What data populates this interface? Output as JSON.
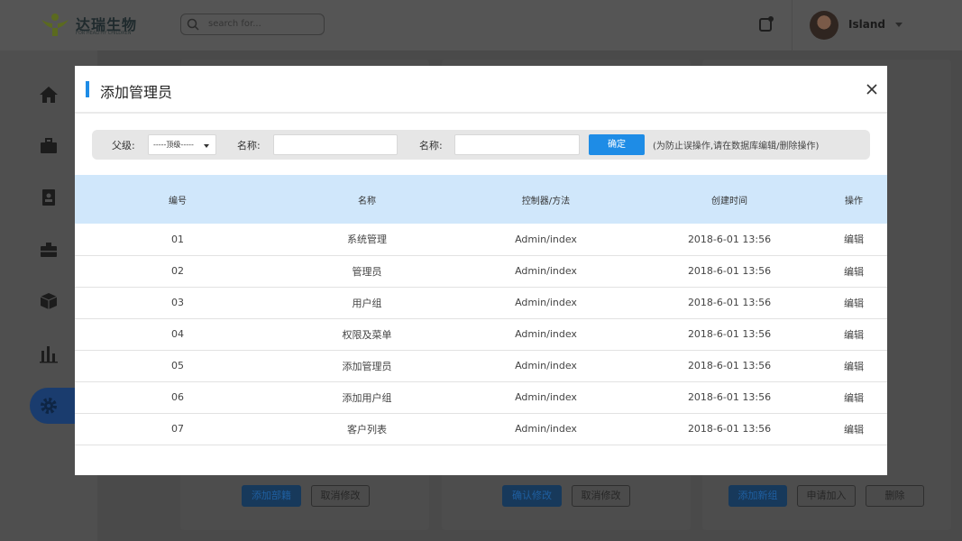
{
  "header": {
    "brand_name": "达瑞生物",
    "brand_tagline": "FOR HEALTHY CHILDREN",
    "search_placeholder": "search for...",
    "username": "Island"
  },
  "background_buttons": {
    "panel1": [
      "添加部籍",
      "取消修改"
    ],
    "panel2": [
      "确认修改",
      "取消修改"
    ],
    "panel3": [
      "添加新组",
      "申请加入",
      "删除"
    ]
  },
  "modal": {
    "title": "添加管理员",
    "filter": {
      "parent_label": "父级:",
      "parent_value": "-----顶级-----",
      "name_label_1": "名称:",
      "name_value_1": "",
      "name_label_2": "名称:",
      "name_value_2": "",
      "confirm_label": "确定",
      "note": "(为防止误操作,请在数据库编辑/删除操作)"
    },
    "table": {
      "columns": [
        "编号",
        "名称",
        "控制器/方法",
        "创建时间",
        "操作"
      ],
      "rows": [
        {
          "id": "01",
          "name": "系统管理",
          "controller": "Admin/index",
          "created": "2018-6-01  13:56",
          "action": "编辑"
        },
        {
          "id": "02",
          "name": "管理员",
          "controller": "Admin/index",
          "created": "2018-6-01  13:56",
          "action": "编辑"
        },
        {
          "id": "03",
          "name": "用户组",
          "controller": "Admin/index",
          "created": "2018-6-01  13:56",
          "action": "编辑"
        },
        {
          "id": "04",
          "name": "权限及菜单",
          "controller": "Admin/index",
          "created": "2018-6-01  13:56",
          "action": "编辑"
        },
        {
          "id": "05",
          "name": "添加管理员",
          "controller": "Admin/index",
          "created": "2018-6-01  13:56",
          "action": "编辑"
        },
        {
          "id": "06",
          "name": "添加用户组",
          "controller": "Admin/index",
          "created": "2018-6-01  13:56",
          "action": "编辑"
        },
        {
          "id": "07",
          "name": "客户列表",
          "controller": "Admin/index",
          "created": "2018-6-01  13:56",
          "action": "编辑"
        }
      ]
    }
  },
  "colors": {
    "accent": "#1e8ce6",
    "table_header_bg": "#d0e7fb",
    "overlay": "#4a4a4a"
  }
}
